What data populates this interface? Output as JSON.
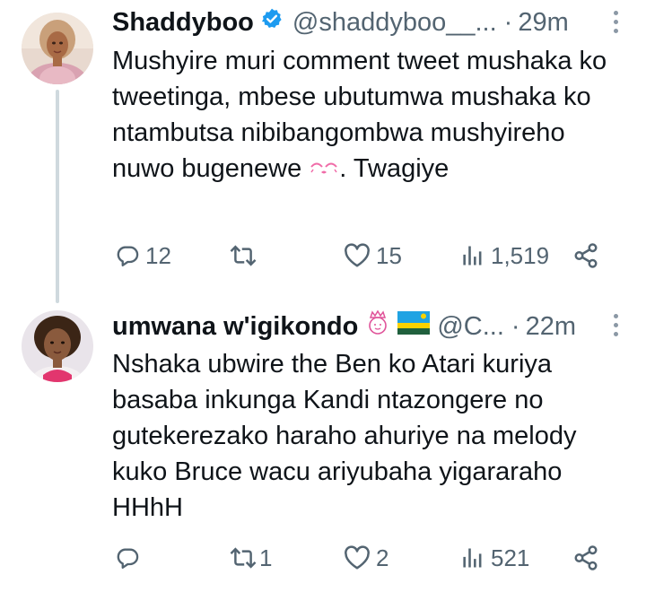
{
  "tweet1": {
    "display_name": "Shaddyboo",
    "handle": "@shaddyboo__...",
    "separator": "·",
    "time": "29m",
    "text_before_emoji": "Mushyire muri comment tweet mushaka ko tweetinga, mbese ubutumwa mushaka ko ntambutsa nibibangombwa mushyireho nuwo bugenewe ",
    "text_after_emoji": ". Twagiye",
    "replies": "12",
    "retweets": "",
    "likes": "15",
    "views": "1,519"
  },
  "tweet2": {
    "display_name": "umwana w'igikondo",
    "handle": "@C...",
    "separator": "·",
    "time": "22m",
    "text": "Nshaka ubwire the Ben ko Atari kuriya basaba inkunga Kandi ntazongere no gutekerezako haraho ahuriye na melody kuko Bruce wacu ariyubaha yigararaho HHhH",
    "replies": "",
    "retweets": "1",
    "likes": "2",
    "views": "521"
  },
  "colors": {
    "verified": "#1d9bf0",
    "muted_text": "#536471",
    "thread_line": "#cfd9de",
    "emoji_pink": "#f06ca8"
  },
  "icons": [
    "verified-badge-icon",
    "more-icon",
    "reply-icon",
    "retweet-icon",
    "like-icon",
    "views-icon",
    "share-icon",
    "princess-emoji-icon",
    "rwanda-flag-icon",
    "kiss-emoji-icon"
  ]
}
